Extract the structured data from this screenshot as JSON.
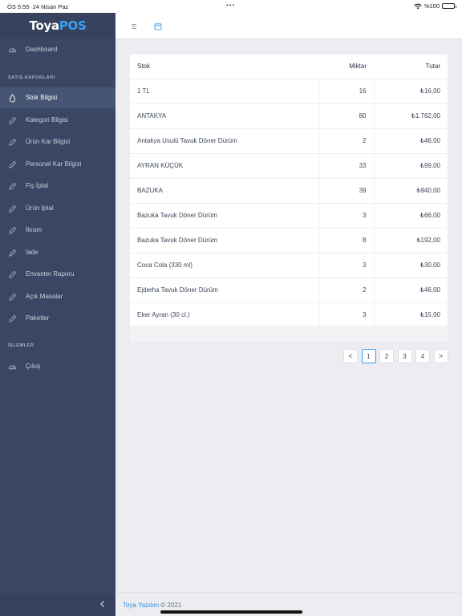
{
  "status": {
    "time": "ÖS 5:55",
    "date": "24 Nisan Paz",
    "dots": "•••",
    "battery": "%100"
  },
  "logo": {
    "part1": "Toya",
    "part2": "POS"
  },
  "sidebar": {
    "dashboard": "Dashboard",
    "section_sales": "SATIŞ RAPORLARI",
    "items": [
      {
        "label": "Stok Bilgisi",
        "icon": "drop-icon"
      },
      {
        "label": "Kategori Bilgisi",
        "icon": "pencil-icon"
      },
      {
        "label": "Ürün Kar Bilgisi",
        "icon": "pencil-icon"
      },
      {
        "label": "Personel Kar Bilgisi",
        "icon": "pencil-icon"
      },
      {
        "label": "Fiş İptal",
        "icon": "pencil-icon"
      },
      {
        "label": "Ürün İptal",
        "icon": "pencil-icon"
      },
      {
        "label": "İkram",
        "icon": "pencil-icon"
      },
      {
        "label": "İade",
        "icon": "pencil-icon"
      },
      {
        "label": "Envanter Raporu",
        "icon": "pencil-icon"
      },
      {
        "label": "Açık Masalar",
        "icon": "pencil-icon"
      },
      {
        "label": "Paketler",
        "icon": "pencil-icon"
      }
    ],
    "section_actions": "İŞLEMLER",
    "logout": "Çıkış"
  },
  "table": {
    "headers": {
      "stok": "Stok",
      "miktar": "Miktar",
      "tutar": "Tutar"
    },
    "rows": [
      {
        "stok": "1 TL",
        "miktar": "16",
        "tutar": "₺16,00"
      },
      {
        "stok": "ANTAKYA",
        "miktar": "80",
        "tutar": "₺1.762,00"
      },
      {
        "stok": "Antakya Usulü Tavuk Döner Dürüm",
        "miktar": "2",
        "tutar": "₺46,00"
      },
      {
        "stok": "AYRAN KÜÇÜK",
        "miktar": "33",
        "tutar": "₺99,00"
      },
      {
        "stok": "BAZUKA",
        "miktar": "39",
        "tutar": "₺940,00"
      },
      {
        "stok": "Bazuka Tavuk Döner Dürüm",
        "miktar": "3",
        "tutar": "₺66,00"
      },
      {
        "stok": "Bazuka Tavuk Döner Dürüm",
        "miktar": "8",
        "tutar": "₺192,00"
      },
      {
        "stok": "Coca Cola (330 ml)",
        "miktar": "3",
        "tutar": "₺30,00"
      },
      {
        "stok": "Ejderha Tavuk Döner Dürüm",
        "miktar": "2",
        "tutar": "₺46,00"
      },
      {
        "stok": "Eker Ayran (30 cl.)",
        "miktar": "3",
        "tutar": "₺15,00"
      }
    ]
  },
  "pagination": {
    "prev": "<",
    "pages": [
      "1",
      "2",
      "3",
      "4"
    ],
    "current": "1",
    "next": ">"
  },
  "footer": {
    "brand": "Toya Yazılım",
    "suffix": " © 2021"
  },
  "colors": {
    "sidebar_bg": "#3a4764",
    "sidebar_active": "#465573",
    "accent": "#3aa0f2",
    "content_bg": "#ebedf0"
  }
}
